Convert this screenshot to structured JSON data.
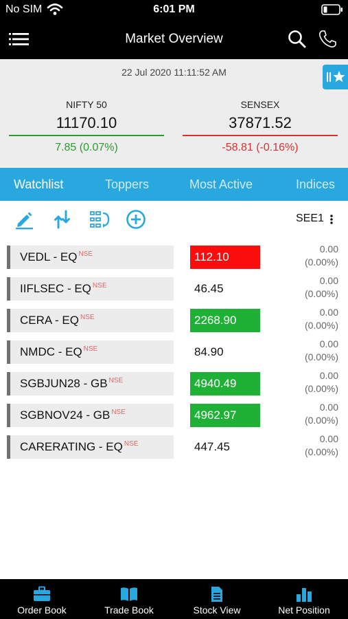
{
  "status": {
    "carrier": "No SIM",
    "time": "6:01 PM"
  },
  "header": {
    "title": "Market Overview"
  },
  "market": {
    "timestamp": "22 Jul 2020 11:11:52 AM",
    "indices": [
      {
        "name": "NIFTY 50",
        "value": "11170.10",
        "change": "7.85 (0.07%)",
        "direction": "up",
        "color": "#2a9d2a"
      },
      {
        "name": "SENSEX",
        "value": "37871.52",
        "change": "-58.81 (-0.16%)",
        "direction": "down",
        "color": "#d93030"
      }
    ]
  },
  "tabs": [
    {
      "label": "Watchlist",
      "active": true
    },
    {
      "label": "Toppers",
      "active": false
    },
    {
      "label": "Most Active",
      "active": false
    },
    {
      "label": "Indices",
      "active": false
    }
  ],
  "toolbar": {
    "list_name": "SEE1",
    "icons": [
      "edit-icon",
      "sort-icon",
      "reorder-icon",
      "add-icon"
    ]
  },
  "watchlist": [
    {
      "symbol": "VEDL  - EQ",
      "exchange": "NSE",
      "ltp": "112.10",
      "state": "down",
      "change": "0.00",
      "pct": "(0.00%)"
    },
    {
      "symbol": "IIFLSEC  - EQ",
      "exchange": "NSE",
      "ltp": "46.45",
      "state": "none",
      "change": "0.00",
      "pct": "(0.00%)"
    },
    {
      "symbol": "CERA  - EQ",
      "exchange": "NSE",
      "ltp": "2268.90",
      "state": "up",
      "change": "0.00",
      "pct": "(0.00%)"
    },
    {
      "symbol": "NMDC  - EQ",
      "exchange": "NSE",
      "ltp": "84.90",
      "state": "none",
      "change": "0.00",
      "pct": "(0.00%)"
    },
    {
      "symbol": "SGBJUN28  - GB",
      "exchange": "NSE",
      "ltp": "4940.49",
      "state": "up",
      "change": "0.00",
      "pct": "(0.00%)"
    },
    {
      "symbol": "SGBNOV24  - GB",
      "exchange": "NSE",
      "ltp": "4962.97",
      "state": "up",
      "change": "0.00",
      "pct": "(0.00%)"
    },
    {
      "symbol": "CARERATING  - EQ",
      "exchange": "NSE",
      "ltp": "447.45",
      "state": "none",
      "change": "0.00",
      "pct": "(0.00%)"
    }
  ],
  "bottom_nav": [
    {
      "label": "Order Book",
      "icon": "briefcase-icon"
    },
    {
      "label": "Trade Book",
      "icon": "book-icon"
    },
    {
      "label": "Stock View",
      "icon": "document-icon"
    },
    {
      "label": "Net Position",
      "icon": "bar-chart-icon"
    }
  ],
  "colors": {
    "accent": "#29a8e0",
    "up": "#1fb136",
    "down": "#fb0d0d"
  }
}
